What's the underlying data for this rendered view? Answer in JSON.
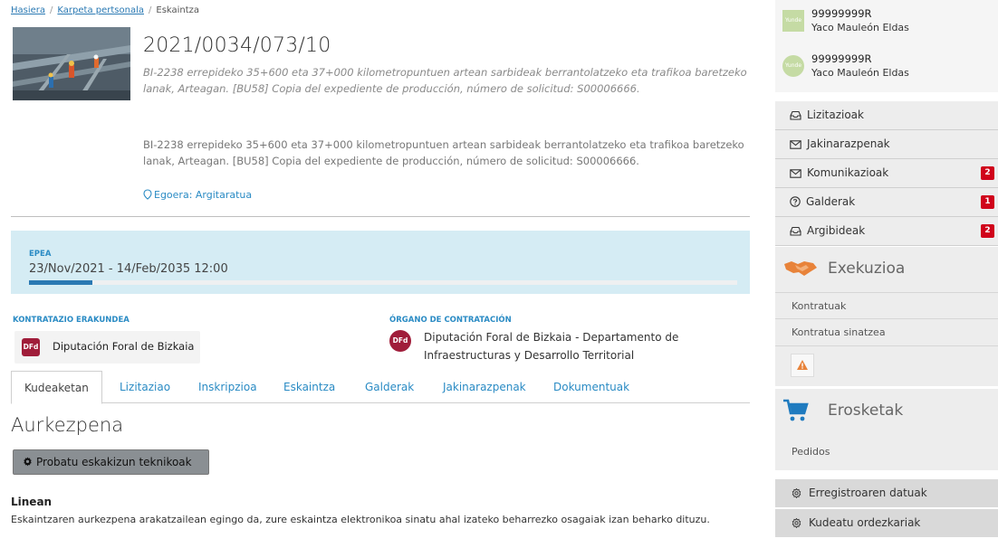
{
  "breadcrumb": {
    "home": "Hasiera",
    "folder": "Karpeta pertsonala",
    "current": "Eskaintza"
  },
  "header": {
    "title": "2021/0034/073/10",
    "description_italic": "BI-2238 errepideko 35+600 eta 37+000 kilometropuntuen artean sarbideak berrantolatzeko eta trafikoa baretzeko lanak, Arteagan. [BU58] Copia del expediente de producción, número de solicitud: S00006666.",
    "description": "BI-2238 errepideko 35+600 eta 37+000 kilometropuntuen artean sarbideak berrantolatzeko eta trafikoa baretzeko lanak, Arteagan. [BU58] Copia del expediente de producción, número de solicitud: S00006666.",
    "status": "Egoera: Argitaratua"
  },
  "deadline": {
    "label": "EPEA",
    "dates": "23/Nov/2021 - 14/Feb/2035 12:00",
    "progress_percent": 9
  },
  "organization": {
    "left_label": "KONTRATAZIO ERAKUNDEA",
    "left_logo": "DFd",
    "left_name": "Diputación Foral de Bizkaia",
    "right_label": "ÓRGANO DE CONTRATACIÓN",
    "right_logo": "DFd",
    "right_name": "Diputación Foral de Bizkaia - Departamento de Infraestructuras y Desarrollo Territorial"
  },
  "tabs": [
    {
      "label": "Kudeaketan",
      "active": true
    },
    {
      "label": "Lizitaziao"
    },
    {
      "label": "Inskripzioa"
    },
    {
      "label": "Eskaintza"
    },
    {
      "label": "Galderak"
    },
    {
      "label": "Jakinarazpenak"
    },
    {
      "label": "Dokumentuak"
    }
  ],
  "content": {
    "heading": "Aurkezpena",
    "test_button": "Probatu eskakizun teknikoak",
    "online_title": "Linean",
    "online_text": "Eskaintzaren aurkezpena arakatzailean egingo da, zure eskaintza elektronikoa sinatu ahal izateko beharrezko osagaiak izan beharko dituzu."
  },
  "sidebar": {
    "users": [
      {
        "avatar": "Yunde",
        "id": "99999999R",
        "name": "Yaco Mauleón Eldas"
      },
      {
        "avatar": "Yunde",
        "id": "99999999R",
        "name": "Yaco Mauleón Eldas"
      }
    ],
    "menu": [
      {
        "label": "Lizitazioak",
        "icon": "inbox-icon"
      },
      {
        "label": "Jakinarazpenak",
        "icon": "envelope-icon"
      },
      {
        "label": "Komunikazioak",
        "icon": "envelope-icon",
        "badge": "2"
      },
      {
        "label": "Galderak",
        "icon": "question-icon",
        "badge": "1"
      },
      {
        "label": "Argibideak",
        "icon": "inbox-icon",
        "badge": "2"
      }
    ],
    "execution": {
      "title": "Exekuzioa",
      "items": [
        "Kontratuak",
        "Kontratua sinatzea"
      ]
    },
    "shopping": {
      "title": "Erosketak",
      "items": [
        "Pedidos"
      ]
    },
    "settings": {
      "registry": "Erregistroaren datuak",
      "representatives": "Kudeatu ordezkariak"
    }
  },
  "colors": {
    "link": "#2a8bc4",
    "badge": "#d0021b",
    "epea_bg": "#d5ecf4",
    "dfd": "#a01d3a"
  }
}
